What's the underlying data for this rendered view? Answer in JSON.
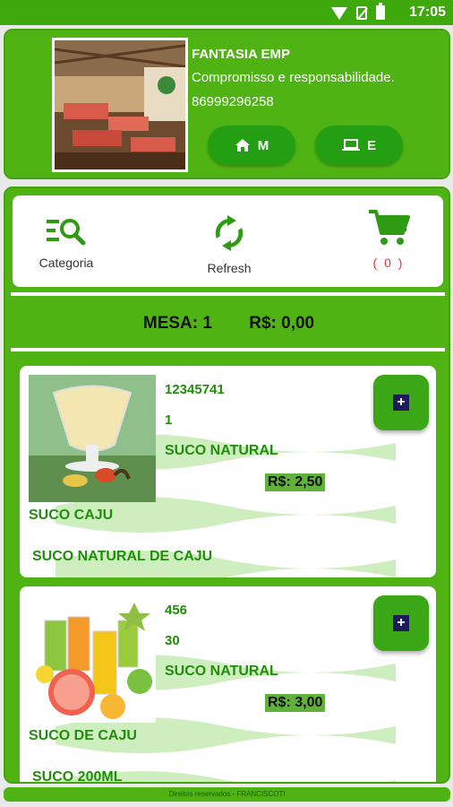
{
  "status_bar": {
    "time": "17:05",
    "icons": [
      "wifi-icon",
      "no-sim-icon",
      "battery-icon"
    ]
  },
  "header": {
    "company_name": "FANTASIA EMP",
    "slogan": "Compromisso e responsabilidade.",
    "phone": "86999296258",
    "buttons": [
      {
        "icon": "home-icon",
        "label": "M"
      },
      {
        "icon": "laptop-icon",
        "label": "E"
      }
    ]
  },
  "toolbar": {
    "category_label": "Categoria",
    "refresh_label": "Refresh",
    "cart_count": "( 0 )"
  },
  "totals": {
    "mesa": "MESA: 1",
    "amount": "R$: 0,00"
  },
  "products": [
    {
      "code": "12345741",
      "qty": "1",
      "category": "SUCO NATURAL",
      "price": "R$: 2,50",
      "name": "SUCO CAJU",
      "description": "SUCO NATURAL DE CAJU"
    },
    {
      "code": "456",
      "qty": "30",
      "category": "SUCO NATURAL",
      "price": "R$: 3,00",
      "name": "SUCO DE CAJU",
      "description": "SUCO 200ML"
    }
  ],
  "footer": "Direitos reservados - FRANCISCOTI",
  "colors": {
    "primary_green": "#4fb314",
    "dark_green": "#249f13",
    "text_green": "#1f8f0a",
    "cart_count_red": "#e53935"
  }
}
